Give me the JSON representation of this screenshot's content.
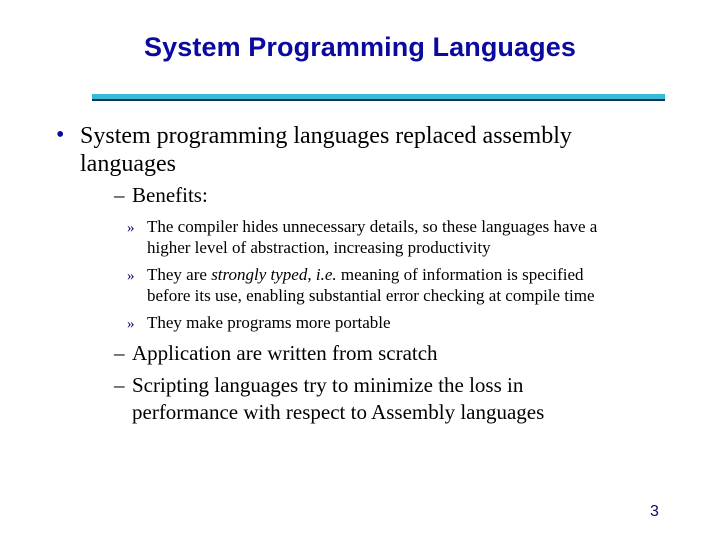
{
  "slide": {
    "title": "System Programming Languages",
    "page_number": "3",
    "colors": {
      "title": "#0a0a9e",
      "rule": "#39b8d8",
      "rule_shadow": "#0b3558",
      "bullet": "#0a0a9e",
      "text": "#000000"
    },
    "bullets": [
      {
        "marker": "•",
        "text": "System programming languages replaced assembly languages",
        "lines": [
          "System programming languages replaced assembly",
          "languages"
        ],
        "children": [
          {
            "marker": "–",
            "text": "Benefits:",
            "children": [
              {
                "marker": "»",
                "lines": [
                  "The compiler hides unnecessary details, so these languages have a",
                  "higher level of abstraction, increasing productivity"
                ]
              },
              {
                "marker": "»",
                "parts": {
                  "pre": "They are ",
                  "italic1": "strongly typed",
                  "mid": ", ",
                  "italic2": "i.e.",
                  "post": " meaning of information is specified"
                },
                "line2": "before its use, enabling substantial error checking at compile time"
              },
              {
                "marker": "»",
                "lines": [
                  "They make programs more portable"
                ]
              }
            ]
          },
          {
            "marker": "–",
            "text": "Application are written from scratch"
          },
          {
            "marker": "–",
            "lines": [
              "Scripting languages try to minimize the loss in",
              "performance with respect to Assembly languages"
            ]
          }
        ]
      }
    ]
  }
}
